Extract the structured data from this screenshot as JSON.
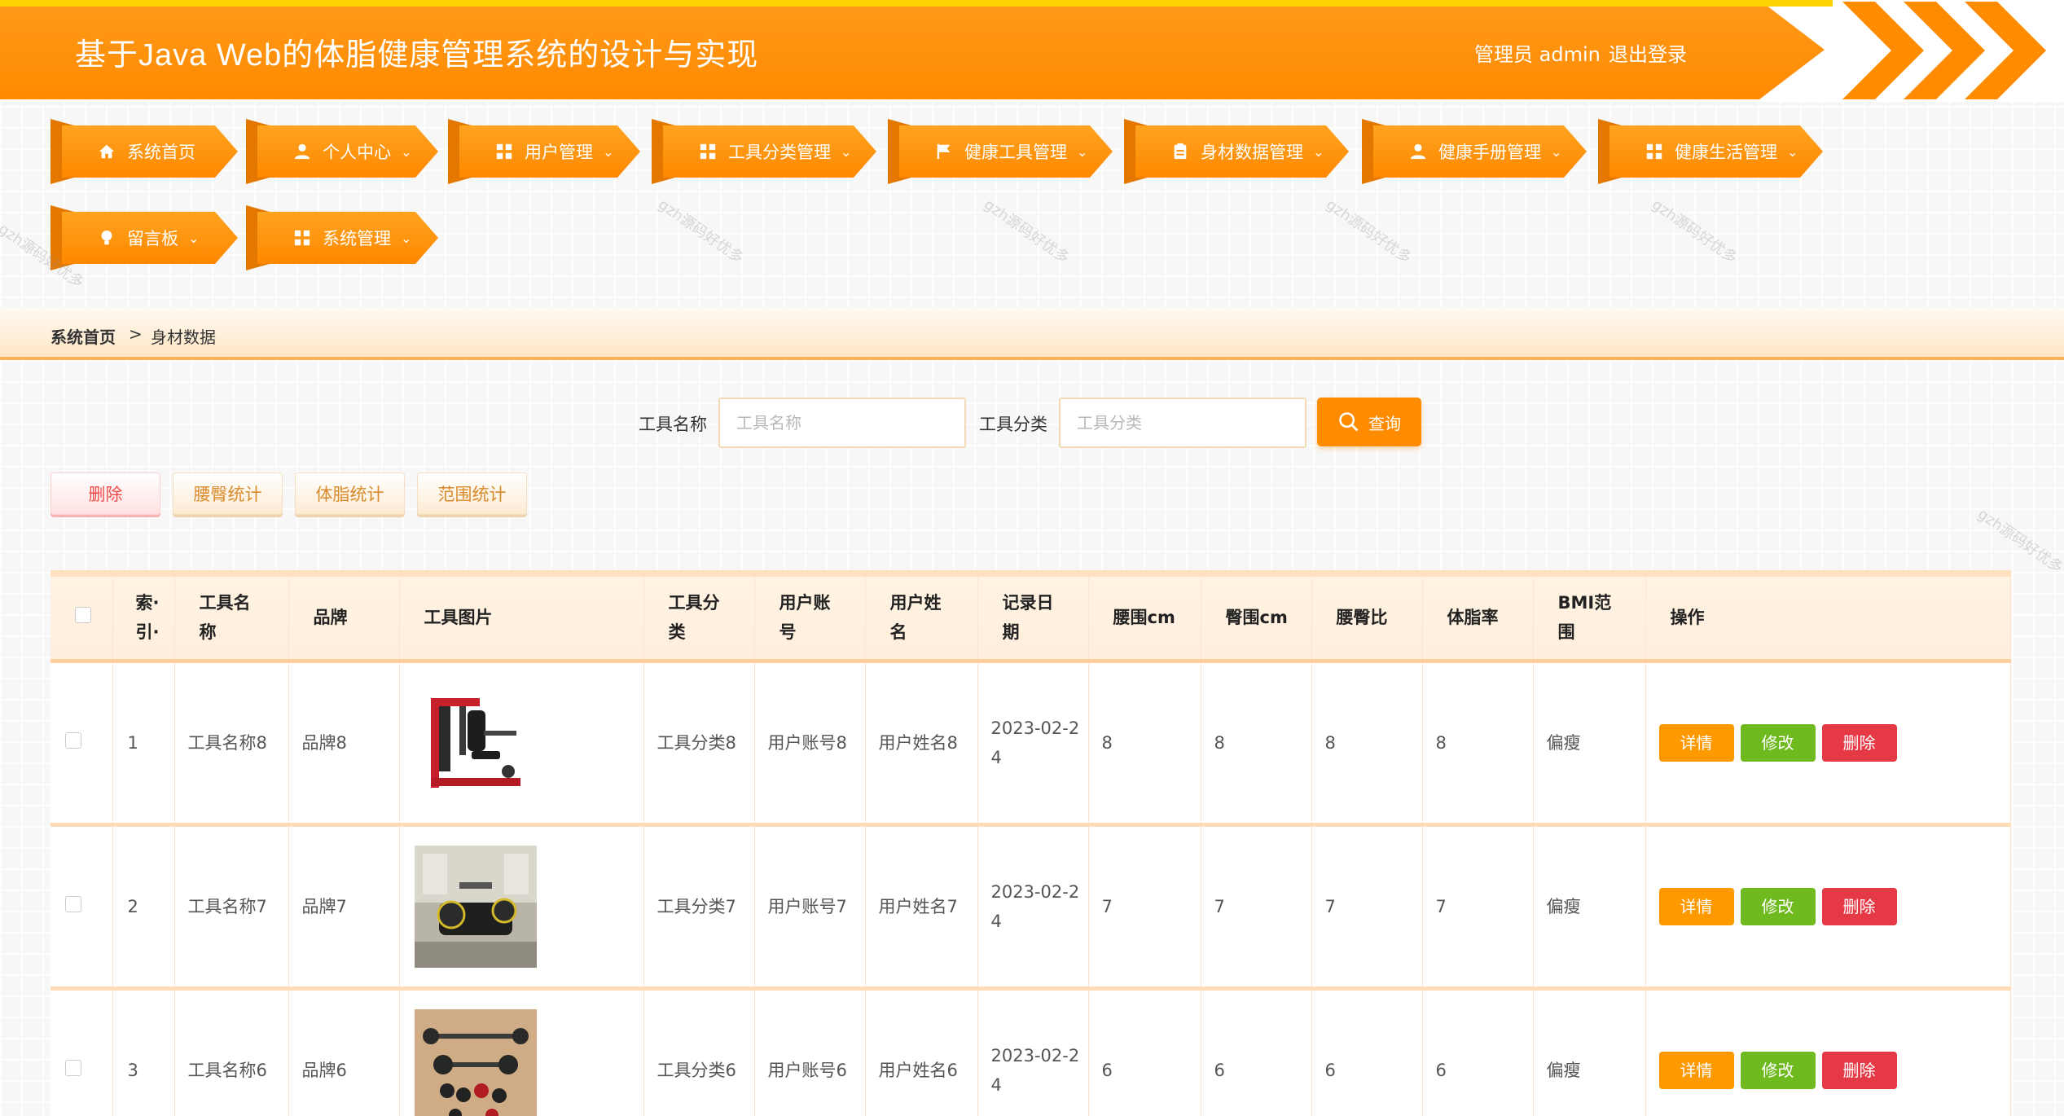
{
  "header": {
    "title": "基于Java Web的体脂健康管理系统的设计与实现",
    "user": "管理员 admin",
    "logout": "退出登录",
    "accent": "#ff8c00"
  },
  "nav": [
    {
      "label": "系统首页",
      "icon": "home-icon"
    },
    {
      "label": "个人中心",
      "icon": "user-icon"
    },
    {
      "label": "用户管理",
      "icon": "grid-icon"
    },
    {
      "label": "工具分类管理",
      "icon": "grid-icon"
    },
    {
      "label": "健康工具管理",
      "icon": "flag-icon"
    },
    {
      "label": "身材数据管理",
      "icon": "clipboard-icon"
    },
    {
      "label": "健康手册管理",
      "icon": "user-icon"
    },
    {
      "label": "健康生活管理",
      "icon": "grid-icon"
    },
    {
      "label": "留言板",
      "icon": "bulb-icon"
    },
    {
      "label": "系统管理",
      "icon": "grid-icon"
    }
  ],
  "breadcrumb": {
    "home": "系统首页",
    "sep": ">",
    "current": "身材数据"
  },
  "search": {
    "name_label": "工具名称",
    "name_placeholder": "工具名称",
    "category_label": "工具分类",
    "category_placeholder": "工具分类",
    "button": "查询"
  },
  "actions": {
    "delete": "删除",
    "waist_hip": "腰臀统计",
    "body_fat": "体脂统计",
    "range": "范围统计"
  },
  "table": {
    "headers": [
      "索·引·",
      "工具名称",
      "品牌",
      "工具图片",
      "工具分类",
      "用户账号",
      "用户姓名",
      "记录日期",
      "腰围cm",
      "臀围cm",
      "腰臀比",
      "体脂率",
      "BMI范围",
      "操作"
    ],
    "header_lines": {
      "index": [
        "索·",
        "引·"
      ],
      "name": [
        "工具名",
        "称"
      ],
      "category": [
        "工具分",
        "类"
      ],
      "account": [
        "用户账",
        "号"
      ],
      "username": [
        "用户姓",
        "名"
      ],
      "date": [
        "记录日",
        "期"
      ],
      "bmi": [
        "BMI范",
        "围"
      ]
    },
    "rows": [
      {
        "index": "1",
        "name": "工具名称8",
        "brand": "品牌8",
        "image": "gym-machine",
        "category": "工具分类8",
        "account": "用户账号8",
        "username": "用户姓名8",
        "date_a": "2023-02-2",
        "date_b": "4",
        "waist": "8",
        "hip": "8",
        "ratio": "8",
        "fat": "8",
        "bmi": "偏瘦"
      },
      {
        "index": "2",
        "name": "工具名称7",
        "brand": "品牌7",
        "image": "gym-room",
        "category": "工具分类7",
        "account": "用户账号7",
        "username": "用户姓名7",
        "date_a": "2023-02-2",
        "date_b": "4",
        "waist": "7",
        "hip": "7",
        "ratio": "7",
        "fat": "7",
        "bmi": "偏瘦"
      },
      {
        "index": "3",
        "name": "工具名称6",
        "brand": "品牌6",
        "image": "dumbbells",
        "category": "工具分类6",
        "account": "用户账号6",
        "username": "用户姓名6",
        "date_a": "2023-02-2",
        "date_b": "4",
        "waist": "6",
        "hip": "6",
        "ratio": "6",
        "fat": "6",
        "bmi": "偏瘦"
      }
    ],
    "ops": {
      "detail": "详情",
      "edit": "修改",
      "delete": "删除"
    }
  },
  "watermark": "gzh源码好优多"
}
